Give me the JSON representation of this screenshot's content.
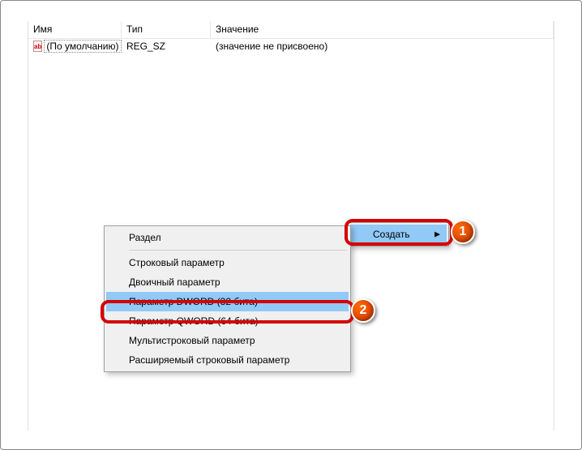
{
  "columns": {
    "name": "Имя",
    "type": "Тип",
    "value": "Значение"
  },
  "rows": [
    {
      "icon": "ab",
      "name": "(По умолчанию)",
      "type": "REG_SZ",
      "value": "(значение не присвоено)"
    }
  ],
  "parent_menu": {
    "create": "Создать"
  },
  "submenu": {
    "key": "Раздел",
    "string": "Строковый параметр",
    "binary": "Двоичный параметр",
    "dword": "Параметр DWORD (32 бита)",
    "qword": "Параметр QWORD (64 бита)",
    "multistring": "Мультистроковый параметр",
    "expandstring": "Расширяемый строковый параметр"
  },
  "badges": {
    "b1": "1",
    "b2": "2"
  }
}
